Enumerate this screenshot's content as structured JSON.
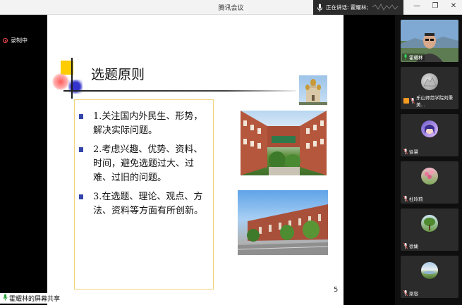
{
  "window": {
    "title": "腾讯会议"
  },
  "speaking": {
    "text": "正在讲话: 霍耀林;"
  },
  "recording": {
    "label": "录制中"
  },
  "slide": {
    "title": "选题原则",
    "items": [
      "1.关注国内外民生、形势，解决实际问题。",
      "2.考虑兴趣、优势、资料、时间，避免选题过大、过难、过旧的问题。",
      "3.在选题、理论、观点、方法、资料等方面有所创新。"
    ],
    "page_number": "5"
  },
  "share": {
    "label": "霍耀林的屏幕共享"
  },
  "participants": [
    {
      "name": "霍耀林",
      "icon": "webcam-video"
    },
    {
      "name": "乐山师范学院刘秉美...",
      "icon": "rock-avatar"
    },
    {
      "name": "徐慧",
      "icon": "anime-avatar"
    },
    {
      "name": "杜玲莉",
      "icon": "flower-avatar"
    },
    {
      "name": "徐婕",
      "icon": "tree-avatar"
    },
    {
      "name": "梁容",
      "icon": "landscape-avatar"
    }
  ],
  "colors": {
    "bullet": "#3344aa",
    "textbox_border": "#f2d27a",
    "record_dot": "#ff4d4d"
  }
}
